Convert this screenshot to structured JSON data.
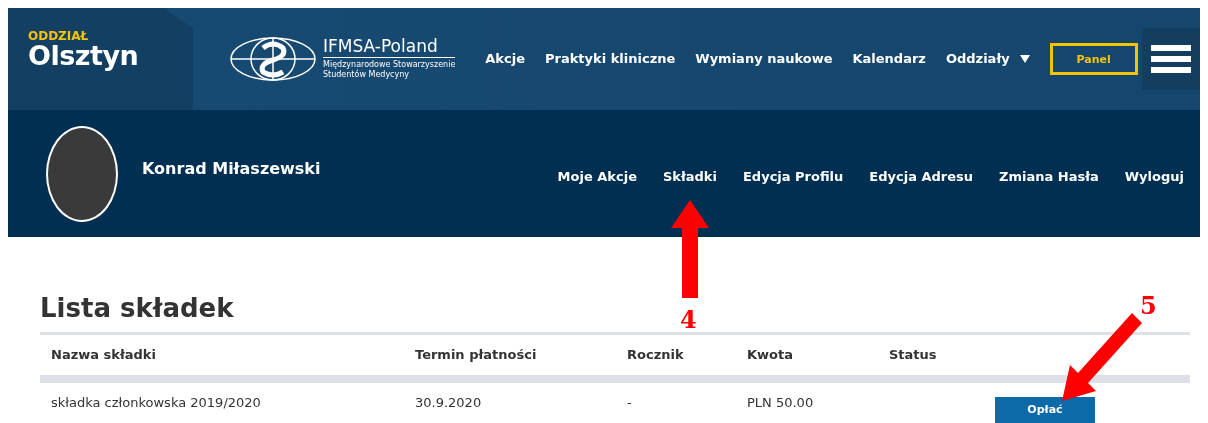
{
  "header": {
    "branch_kicker": "ODDZIAŁ",
    "branch_name": "Olsztyn",
    "logo_name": "IFMSA-Poland",
    "logo_sub": [
      "Międzynarodowe Stowarzyszenie",
      "Studentów Medycyny"
    ],
    "nav": [
      {
        "label": "Akcje",
        "dropdown": false
      },
      {
        "label": "Praktyki kliniczne",
        "dropdown": false
      },
      {
        "label": "Wymiany naukowe",
        "dropdown": false
      },
      {
        "label": "Kalendarz",
        "dropdown": false
      },
      {
        "label": "Oddziały",
        "dropdown": true
      }
    ],
    "panel_button": "Panel"
  },
  "profile": {
    "name": "Konrad Miłaszewski",
    "menu": [
      {
        "label": "Moje Akcje",
        "selected": false
      },
      {
        "label": "Składki",
        "selected": false
      },
      {
        "label": "Edycja Profilu",
        "selected": false
      },
      {
        "label": "Edycja Adresu",
        "selected": false
      },
      {
        "label": "Zmiana Hasła",
        "selected": false
      },
      {
        "label": "Wyloguj",
        "selected": false
      }
    ]
  },
  "title": "Lista składek",
  "table": {
    "columns": [
      "Nazwa składki",
      "Termin płatności",
      "Rocznik",
      "Kwota",
      "Status"
    ],
    "rows": [
      {
        "cells": [
          "składka członkowska 2019/2020",
          "30.9.2020",
          "-",
          "PLN 50.00",
          ""
        ],
        "action": "Opłać"
      }
    ]
  },
  "annotations": [
    {
      "label": "4",
      "kind": "up"
    },
    {
      "label": "5",
      "kind": "diagonal"
    }
  ]
}
